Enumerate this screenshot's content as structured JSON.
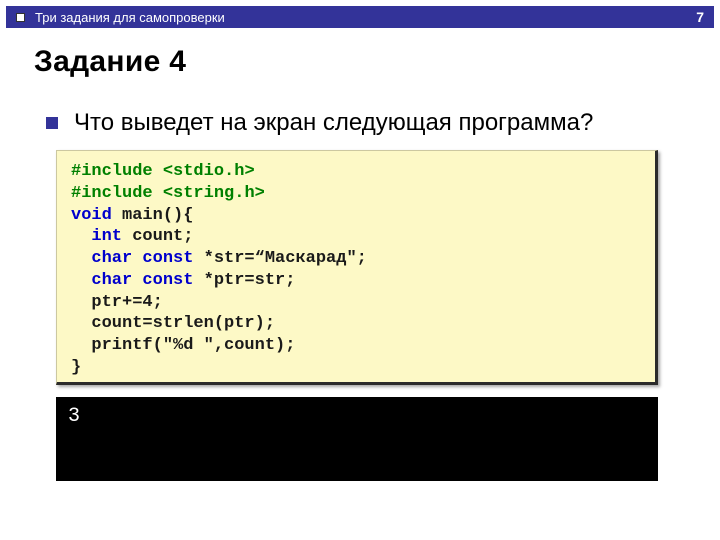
{
  "header": {
    "breadcrumb": "Три задания для самопроверки",
    "page_number": "7"
  },
  "title": "Задание 4",
  "question": "Что выведет на экран следующая программа?",
  "code": {
    "l1a": "#include ",
    "l1b": "<stdio.h>",
    "l2a": "#include ",
    "l2b": "<string.h>",
    "l3a": "void",
    "l3b": " main(){",
    "l4a": "  int",
    "l4b": " count;",
    "l5a": "  char const ",
    "l5b": "*str=“Маскарад\";",
    "l6a": "  char const ",
    "l6b": "*ptr=str;",
    "l7": "  ptr+=4;",
    "l8": "  count=strlen(ptr);",
    "l9": "  printf(\"%d \",count);",
    "l10": "}"
  },
  "output": "3"
}
